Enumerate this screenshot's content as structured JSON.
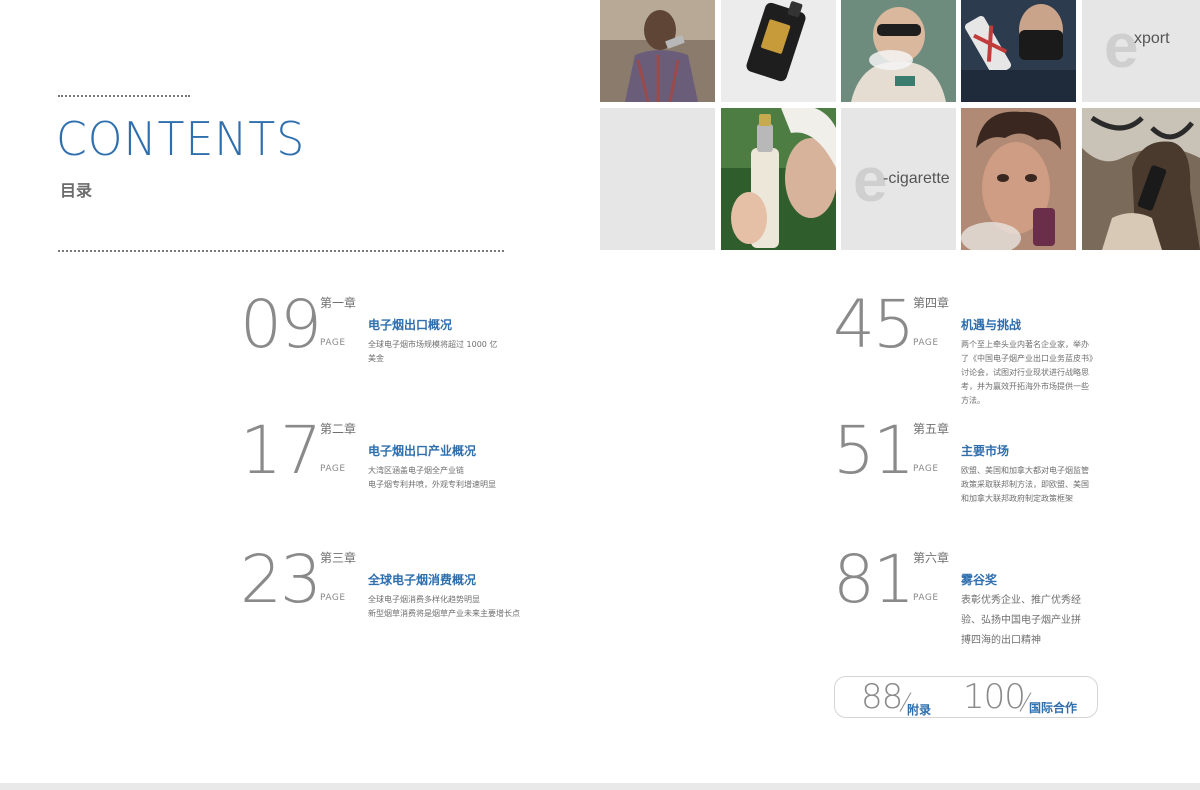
{
  "header": {
    "title": "CONTENTS",
    "subtitle": "目录"
  },
  "brand_tiles": {
    "export": {
      "letter": "e",
      "word": "xport"
    },
    "cigarette": {
      "letter": "e",
      "word": "-cigarette"
    }
  },
  "photos": [
    {
      "icon": "man-vaping-photo",
      "palette": [
        "#6b5b4e",
        "#9a8a7a",
        "#c7b59c"
      ]
    },
    {
      "icon": "vape-device-photo",
      "palette": [
        "#1f1f1f",
        "#3a3a3a",
        "#f2f2f2"
      ]
    },
    {
      "icon": "woman-sunglasses-vaping-photo",
      "palette": [
        "#d9cfc4",
        "#8c7a68",
        "#2b2b2b"
      ]
    },
    {
      "icon": "masked-person-vape-photo",
      "palette": [
        "#2c3e5a",
        "#c23b3b",
        "#e8e8e8"
      ]
    },
    {
      "icon": "woman-holding-vape-photo",
      "palette": [
        "#2f5e2c",
        "#e7e3dd",
        "#bfa89a"
      ]
    },
    {
      "icon": "curly-hair-man-vaping-photo",
      "palette": [
        "#4a3528",
        "#c98f7a",
        "#7b3f2b"
      ]
    },
    {
      "icon": "woman-graffiti-vape-photo",
      "palette": [
        "#5a4a3a",
        "#b8b0a4",
        "#2a2a2a"
      ]
    }
  ],
  "chapters": [
    {
      "num": "09",
      "chapter": "第一章",
      "page": "PAGE",
      "title": "电子烟出口概况",
      "desc": [
        "全球电子烟市场规模将超过 1000 亿",
        "美金"
      ]
    },
    {
      "num": "17",
      "chapter": "第二章",
      "page": "PAGE",
      "title": "电子烟出口产业概况",
      "desc": [
        "大湾区涵盖电子烟全产业链",
        "电子烟专利井喷，外观专利增速明显"
      ]
    },
    {
      "num": "23",
      "chapter": "第三章",
      "page": "PAGE",
      "title": "全球电子烟消费概况",
      "desc": [
        "全球电子烟消费多样化趋势明显",
        "新型烟草消费将是烟草产业未来主要增长点"
      ]
    },
    {
      "num": "45",
      "chapter": "第四章",
      "page": "PAGE",
      "title": "机遇与挑战",
      "desc": [
        "两个至上牵头业内著名企业家，举办",
        "了《中国电子烟产业出口业务蓝皮书》",
        "讨论会，试图对行业现状进行战略思",
        "考，并为赢效开拓海外市场提供一些",
        "方法。"
      ]
    },
    {
      "num": "51",
      "chapter": "第五章",
      "page": "PAGE",
      "title": "主要市场",
      "desc": [
        "欧盟、美国和加拿大都对电子烟监管",
        "政策采取联邦制方法，即欧盟、美国",
        "和加拿大联邦政府制定政策框架"
      ]
    },
    {
      "num": "81",
      "chapter": "第六章",
      "page": "PAGE",
      "title": "雾谷奖",
      "desc": [
        "表彰优秀企业、推广优秀经",
        "验、弘扬中国电子烟产业拼",
        "搏四海的出口精神"
      ]
    }
  ],
  "appendix": [
    {
      "num": "88",
      "label": "附录"
    },
    {
      "num": "100",
      "label": "国际合作"
    }
  ],
  "colors": {
    "accent": "#2f6fae",
    "gray_text": "#8a8a8a",
    "tile_gray": "#e6e6e6"
  }
}
